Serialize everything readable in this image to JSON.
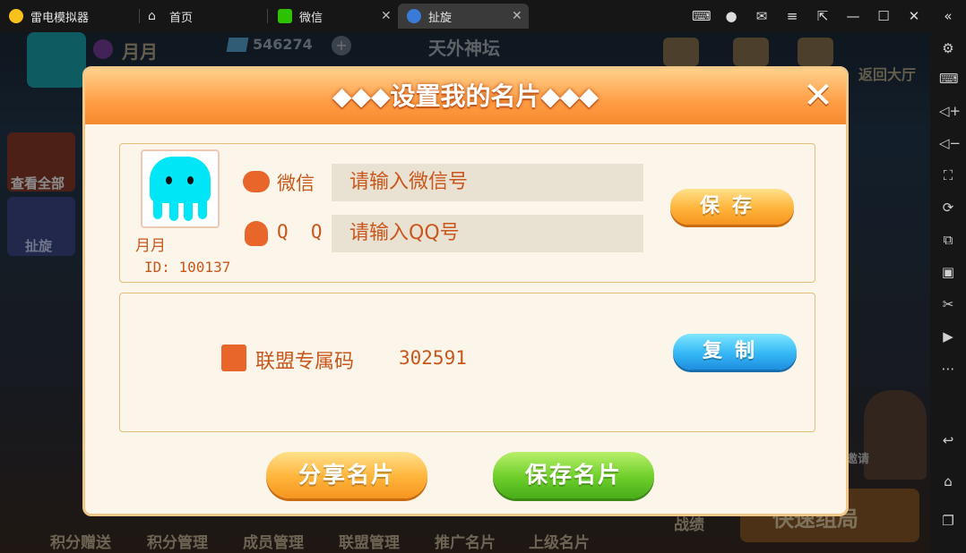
{
  "titlebar": {
    "app_name": "雷电模拟器",
    "tabs": [
      {
        "label": "首页"
      },
      {
        "label": "微信"
      },
      {
        "label": "扯旋"
      }
    ]
  },
  "background": {
    "player_name": "月月",
    "diamonds": "546274",
    "center_title": "天外神坛",
    "return_label": "返回大厅",
    "side_labels": [
      "查看全部",
      "扯旋"
    ],
    "corner_hint": "邀请",
    "bottom_nav": [
      "积分赠送",
      "积分管理",
      "成员管理",
      "联盟管理",
      "推广名片",
      "上级名片",
      "战绩",
      "快速组局"
    ]
  },
  "modal": {
    "title": "◆◆◆设置我的名片◆◆◆",
    "close_glyph": "✕",
    "profile": {
      "name": "月月",
      "id_text": "ID: 100137"
    },
    "wechat": {
      "label": "微信",
      "placeholder": "请输入微信号"
    },
    "qq": {
      "label": "Q  Q",
      "placeholder": "请输入QQ号"
    },
    "save_label": "保存",
    "alliance": {
      "label": "联盟专属码",
      "code": "302591"
    },
    "copy_label": "复制",
    "share_card_label": "分享名片",
    "save_card_label": "保存名片"
  },
  "colors": {
    "accent_orange": "#f58a2f",
    "text_orange": "#c9571c",
    "panel_border": "#e3bd7a",
    "modal_bg": "#fbf5ea",
    "avatar_cyan": "#00e6f6"
  }
}
